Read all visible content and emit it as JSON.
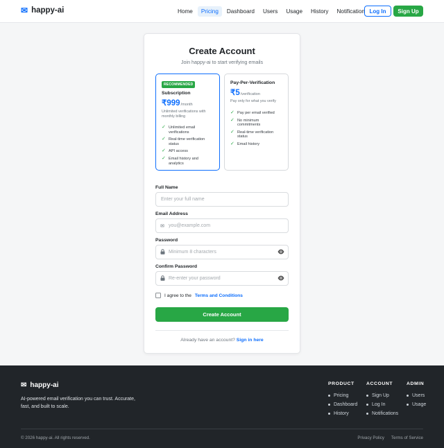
{
  "header": {
    "brand": "happy-ai",
    "nav": [
      "Home",
      "Pricing",
      "Dashboard",
      "Users",
      "Usage",
      "History",
      "Notifications"
    ],
    "login": "Log In",
    "signup": "Sign Up"
  },
  "card": {
    "title": "Create Account",
    "subtitle": "Join happy-ai to start verifying emails",
    "plans": {
      "subscription": {
        "badge": "RECOMMENDED",
        "name": "Subscription",
        "price": "₹999",
        "per": "/month",
        "desc": "Unlimited verifications with monthly billing",
        "features": [
          "Unlimited email verifications",
          "Real-time verification status",
          "API access",
          "Email history and analytics"
        ]
      },
      "ppv": {
        "name": "Pay-Per-Verification",
        "price": "₹5",
        "per": "/verification",
        "desc": "Pay only for what you verify",
        "features": [
          "Pay per email verified",
          "No minimum commitments",
          "Real-time verification status",
          "Email history"
        ]
      }
    },
    "form": {
      "full_name_label": "Full Name",
      "full_name_placeholder": "Enter your full name",
      "email_label": "Email Address",
      "email_placeholder": "you@example.com",
      "password_label": "Password",
      "password_placeholder": "Minimum 8 characters",
      "confirm_label": "Confirm Password",
      "confirm_placeholder": "Re-enter your password",
      "agree_prefix": "I agree to the",
      "agree_link": "Terms and Conditions",
      "submit": "Create Account",
      "signin_prefix": "Already have an account?",
      "signin_link": "Sign in here"
    }
  },
  "footer": {
    "brand": "happy-ai",
    "tagline": "AI-powered email verification you can trust. Accurate, fast, and built to scale.",
    "columns": [
      {
        "title": "PRODUCT",
        "links": [
          "Pricing",
          "Dashboard",
          "History"
        ]
      },
      {
        "title": "ACCOUNT",
        "links": [
          "Sign Up",
          "Log In",
          "Notifications"
        ]
      },
      {
        "title": "ADMIN",
        "links": [
          "Users",
          "Usage"
        ]
      }
    ],
    "copyright": "© 2026 happy-ai. All rights reserved.",
    "privacy": "Privacy Policy",
    "terms": "Terms of Service"
  },
  "colors": {
    "primary": "#0d6efd",
    "success": "#28a745",
    "footer_bg": "#212529"
  },
  "icons": [
    "envelope-icon",
    "lock-icon",
    "eye-icon",
    "check-icon"
  ]
}
